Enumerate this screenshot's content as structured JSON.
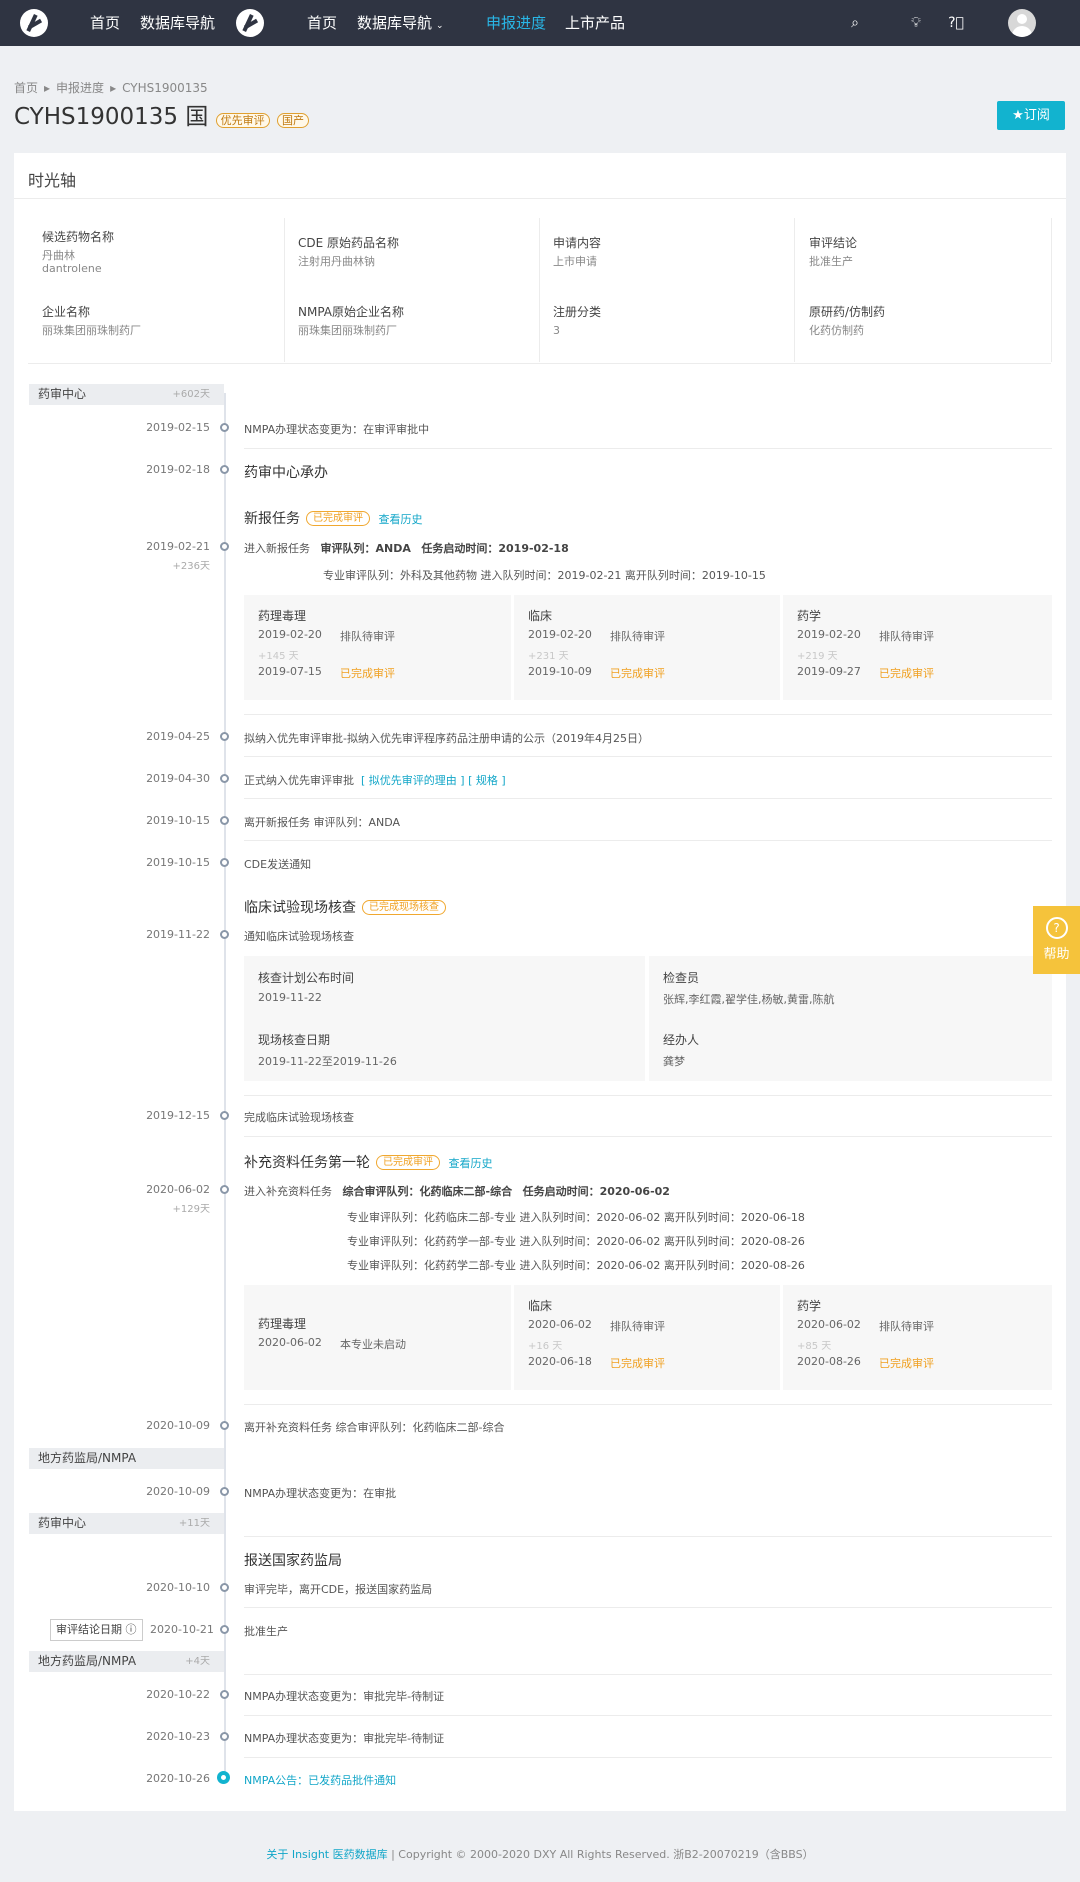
{
  "nav": {
    "home1": "首页",
    "db1": "数据库导航",
    "home2": "首页",
    "db2": "数据库导航",
    "progress": "申报进度",
    "products": "上市产品"
  },
  "breadcrumb": {
    "home": "首页",
    "progress": "申报进度",
    "current": "CYHS1900135"
  },
  "header": {
    "code": "CYHS1900135",
    "flag": "国",
    "tag1": "优先审评",
    "tag2": "国产",
    "subscribe": "★订阅"
  },
  "card_title": "时光轴",
  "info": {
    "drug_name_k": "候选药物名称",
    "drug_name_v": "丹曲林",
    "drug_name_en": "dantrolene",
    "cde_k": "CDE 原始药品名称",
    "cde_v": "注射用丹曲林钠",
    "apply_k": "申请内容",
    "apply_v": "上市申请",
    "concl_k": "审评结论",
    "concl_v": "批准生产",
    "comp_k": "企业名称",
    "comp_v": "丽珠集团丽珠制药厂",
    "nmpa_k": "NMPA原始企业名称",
    "nmpa_v": "丽珠集团丽珠制药厂",
    "reg_k": "注册分类",
    "reg_v": "3",
    "orig_k": "原研药/仿制药",
    "orig_v": "化药仿制药"
  },
  "sections": {
    "s1": {
      "label": "药审中心",
      "days": "+602天"
    },
    "s2": {
      "label": "地方药监局/NMPA"
    },
    "s3": {
      "label": "药审中心",
      "days": "+11天"
    },
    "s4": {
      "label": "地方药监局/NMPA",
      "days": "+4天"
    }
  },
  "events": {
    "e1_date": "2019-02-15",
    "e1": "NMPA办理状态变更为：在审评审批中",
    "e2_date": "2019-02-18",
    "e2": "药审中心承办",
    "task1_title": "新报任务",
    "task1_tag": "已完成审评",
    "task1_link": "查看历史",
    "e3_date": "2019-02-21",
    "e3_days": "+236天",
    "e3_a": "进入新报任务",
    "e3_b": "审评队列：ANDA",
    "e3_c": "任务启动时间：2019-02-18",
    "e3_line2": "专业审评队列：外科及其他药物    进入队列时间：2019-02-21    离开队列时间：2019-10-15",
    "e4_date": "2019-04-25",
    "e4": "拟纳入优先审评审批-拟纳入优先审评程序药品注册申请的公示（2019年4月25日）",
    "e5_date": "2019-04-30",
    "e5": "正式纳入优先审评审批",
    "e5_link": "[ 拟优先审评的理由 ] [ 规格 ]",
    "e6_date": "2019-10-15",
    "e6": "离开新报任务    审评队列：ANDA",
    "e7_date": "2019-10-15",
    "e7": "CDE发送通知",
    "insp_title": "临床试验现场核查",
    "insp_tag": "已完成现场核查",
    "e8_date": "2019-11-22",
    "e8": "通知临床试验现场核查",
    "e9_date": "2019-12-15",
    "e9": "完成临床试验现场核查",
    "task2_title": "补充资料任务第一轮",
    "task2_tag": "已完成审评",
    "task2_link": "查看历史",
    "e10_date": "2020-06-02",
    "e10_days": "+129天",
    "e10_a": "进入补充资料任务",
    "e10_b": "综合审评队列：化药临床二部-综合",
    "e10_c": "任务启动时间：2020-06-02",
    "e10_l1": "专业审评队列：化药临床二部-专业    进入队列时间：2020-06-02    离开队列时间：2020-06-18",
    "e10_l2": "专业审评队列：化药药学一部-专业    进入队列时间：2020-06-02    离开队列时间：2020-08-26",
    "e10_l3": "专业审评队列：化药药学二部-专业    进入队列时间：2020-06-02    离开队列时间：2020-08-26",
    "e11_date": "2020-10-09",
    "e11": "离开补充资料任务    综合审评队列：化药临床二部-综合",
    "e12_date": "2020-10-09",
    "e12": "NMPA办理状态变更为：在审批",
    "send_title": "报送国家药监局",
    "e13_date": "2020-10-10",
    "e13": "审评完毕，离开CDE，报送国家药监局",
    "concl_label": "审评结论日期 ⓘ",
    "e14_date": "2020-10-21",
    "e14": "批准生产",
    "e15_date": "2020-10-22",
    "e15": "NMPA办理状态变更为：审批完毕-待制证",
    "e16_date": "2020-10-23",
    "e16": "NMPA办理状态变更为：审批完毕-待制证",
    "e17_date": "2020-10-26",
    "e17": "NMPA公告：已发药品批件通知"
  },
  "review1": [
    {
      "name": "药理毒理",
      "d1": "2019-02-20",
      "s1": "排队待审评",
      "delta": "+145 天",
      "d2": "2019-07-15",
      "s2": "已完成审评"
    },
    {
      "name": "临床",
      "d1": "2019-02-20",
      "s1": "排队待审评",
      "delta": "+231 天",
      "d2": "2019-10-09",
      "s2": "已完成审评"
    },
    {
      "name": "药学",
      "d1": "2019-02-20",
      "s1": "排队待审评",
      "delta": "+219 天",
      "d2": "2019-09-27",
      "s2": "已完成审评"
    }
  ],
  "inspection": {
    "k1": "核查计划公布时间",
    "v1": "2019-11-22",
    "k2": "检查员",
    "v2": "张辉,李红霞,翟学佳,杨敏,黄雷,陈航",
    "k3": "现场核查日期",
    "v3": "2019-11-22至2019-11-26",
    "k4": "经办人",
    "v4": "龚梦"
  },
  "review2": [
    {
      "name": "药理毒理",
      "d1": "2020-06-02",
      "s1": "本专业未启动"
    },
    {
      "name": "临床",
      "d1": "2020-06-02",
      "s1": "排队待审评",
      "delta": "+16 天",
      "d2": "2020-06-18",
      "s2": "已完成审评"
    },
    {
      "name": "药学",
      "d1": "2020-06-02",
      "s1": "排队待审评",
      "delta": "+85 天",
      "d2": "2020-08-26",
      "s2": "已完成审评"
    }
  ],
  "help": "帮助",
  "footer": {
    "link": "关于 Insight 医药数据库",
    "text": " | Copyright © 2000-2020 DXY All Rights Reserved. 浙B2-20070219（含BBS）"
  }
}
